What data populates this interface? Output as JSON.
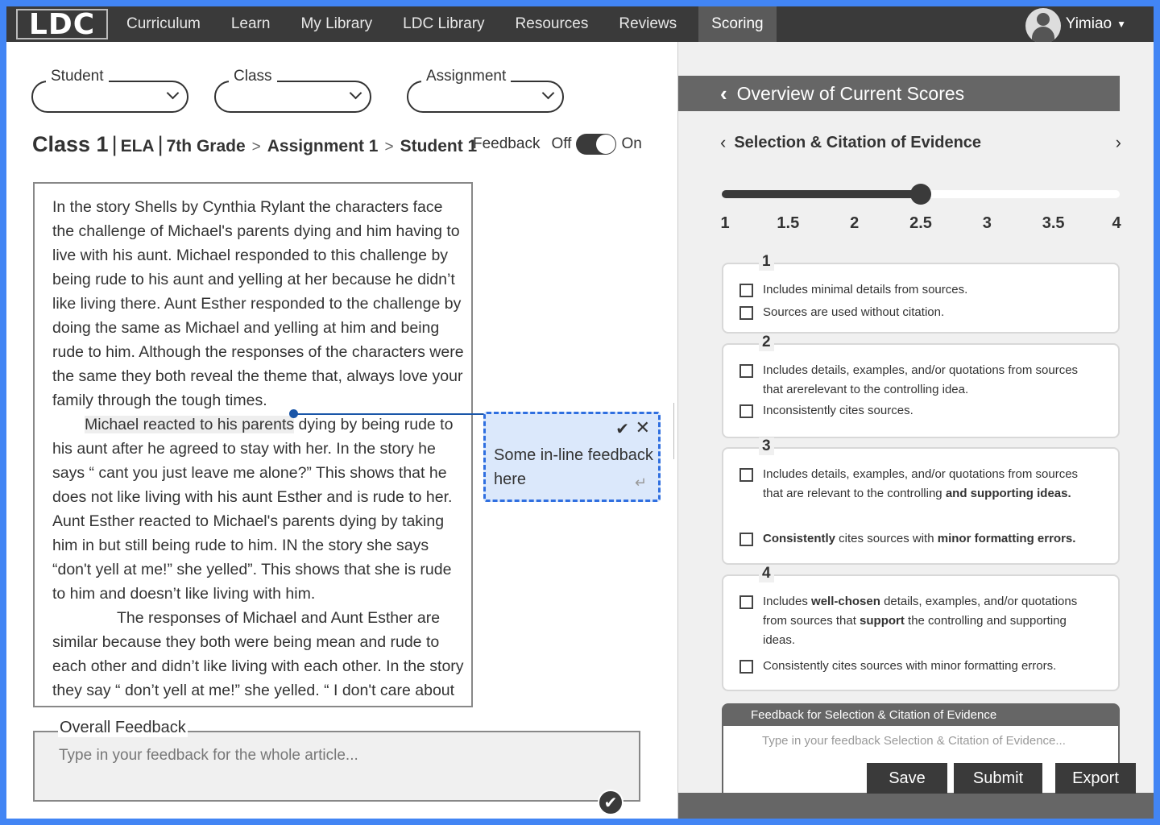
{
  "nav": {
    "logo": "LDC",
    "items": [
      "Curriculum",
      "Learn",
      "My Library",
      "LDC Library",
      "Resources",
      "Reviews"
    ],
    "active": "Scoring",
    "user": "Yimiao"
  },
  "selectors": {
    "student": "Student",
    "class": "Class",
    "assignment": "Assignment"
  },
  "breadcrumb": {
    "class": "Class 1",
    "subject": "ELA",
    "grade": "7th Grade",
    "assignment": "Assignment 1",
    "student": "Student 1"
  },
  "feedback_toggle": {
    "label": "Feedback",
    "off": "Off",
    "on": "On",
    "state": "on"
  },
  "essay": {
    "p1": "In the story Shells by Cynthia Rylant the characters face the challenge of Michael's parents dying and him having to live with his aunt. Michael responded to this challenge by being rude to his aunt and yelling at her because he didn’t like living there. Aunt Esther responded to the challenge by doing the same as Michael and yelling at him and being rude to him. Although the responses of the characters were the same they both reveal the theme that, always love your family through the tough times.",
    "p2_highlight": "Michael reacted to his parents",
    "p2_rest": " dying by being rude to his aunt after he agreed to stay with her. In the story he says “ cant you just leave me alone?” This shows that he does not like living with his aunt Esther and is rude to her.",
    "p3": "Aunt Esther reacted to Michael's parents dying by taking him in but still being rude to him. IN the story she says “don't yell at me!” she yelled”. This shows that she is rude to him and doesn’t like living with him.",
    "p4": "The responses of Michael and Aunt Esther are similar because they both were being mean and rude to each other and didn’t like living with each other. In the story they say “ don’t yell at me!” she yelled. “ I don't care about"
  },
  "inline_feedback": {
    "text": "Some in-line feedback here"
  },
  "overall_feedback": {
    "label": "Overall Feedback",
    "placeholder": "Type in your feedback for the whole article..."
  },
  "scores": {
    "overview_title": "Overview of Current Scores",
    "criterion": "Selection & Citation of Evidence",
    "slider": {
      "min": 1,
      "max": 4,
      "value": 2.5
    },
    "ticks": [
      "1",
      "1.5",
      "2",
      "2.5",
      "3",
      "3.5",
      "4"
    ],
    "levels": [
      {
        "num": "1",
        "items": [
          "Includes minimal details from sources.",
          "Sources are used without citation."
        ]
      },
      {
        "num": "2",
        "items": [
          "Includes details, examples, and/or quotations from sources that arerelevant to the controlling idea.",
          "Inconsistently cites sources."
        ]
      },
      {
        "num": "3",
        "items": [
          "Includes details, examples, and/or quotations from sources that are relevant to the controlling <b>and supporting ideas.</b>",
          "<b>Consistently</b> cites sources with <b>minor formatting errors.</b>"
        ]
      },
      {
        "num": "4",
        "items": [
          "Includes <b>well-chosen</b> details, examples, and/or quotations from sources that <b>support</b> the controlling and supporting ideas.",
          "Consistently cites sources with minor formatting errors."
        ]
      }
    ],
    "feedback_title": "Feedback for Selection & Citation of Evidence",
    "feedback_placeholder": "Type in your feedback Selection & Citation of Evidence..."
  },
  "actions": {
    "save": "Save",
    "submit": "Submit",
    "export": "Export"
  }
}
